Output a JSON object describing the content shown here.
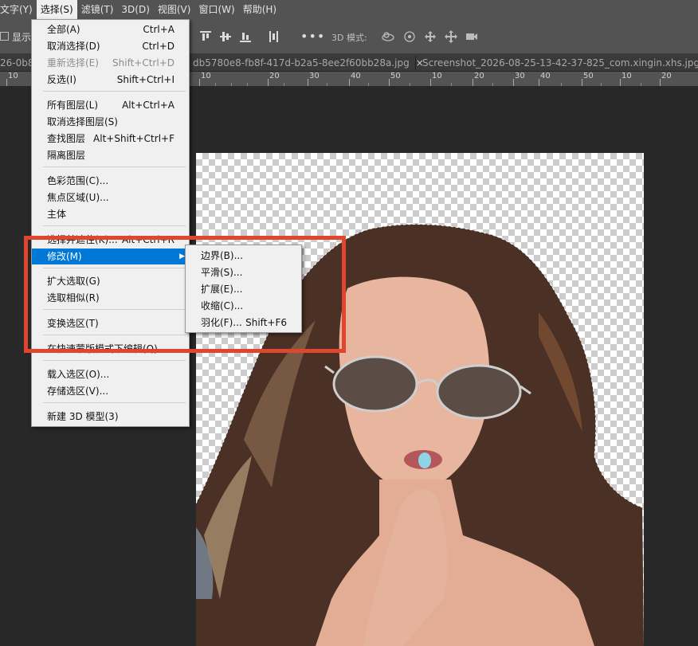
{
  "menubar": {
    "items": [
      "文字(Y)",
      "选择(S)",
      "滤镜(T)",
      "3D(D)",
      "视图(V)",
      "窗口(W)",
      "帮助(H)"
    ],
    "active_index": 1
  },
  "options": {
    "show_label": "显示",
    "label_3d": "3D 模式:",
    "more": "•••"
  },
  "tabs": [
    {
      "label": "26-0b86",
      "close": ""
    },
    {
      "label": "db5780e8-fb8f-417d-b2a5-8ee2f60bb28a.jpg",
      "close": "×"
    },
    {
      "label": "Screenshot_2026-08-25-13-42-37-825_com.xingin.xhs.jpg",
      "close": "×"
    }
  ],
  "ruler": [
    "10",
    "10",
    "20",
    "30",
    "40",
    "50",
    "10",
    "20",
    "30",
    "40",
    "50",
    "10",
    "20"
  ],
  "select_menu": {
    "items": [
      {
        "label": "全部(A)",
        "shortcut": "Ctrl+A",
        "disabled": false
      },
      {
        "label": "取消选择(D)",
        "shortcut": "Ctrl+D",
        "disabled": false
      },
      {
        "label": "重新选择(E)",
        "shortcut": "Shift+Ctrl+D",
        "disabled": true
      },
      {
        "label": "反选(I)",
        "shortcut": "Shift+Ctrl+I",
        "disabled": false
      },
      {
        "label": "所有图层(L)",
        "shortcut": "Alt+Ctrl+A",
        "disabled": false
      },
      {
        "label": "取消选择图层(S)",
        "shortcut": "",
        "disabled": false
      },
      {
        "label": "查找图层",
        "shortcut": "Alt+Shift+Ctrl+F",
        "disabled": false
      },
      {
        "label": "隔离图层",
        "shortcut": "",
        "disabled": false
      },
      {
        "label": "色彩范围(C)...",
        "shortcut": "",
        "disabled": false
      },
      {
        "label": "焦点区域(U)...",
        "shortcut": "",
        "disabled": false
      },
      {
        "label": "主体",
        "shortcut": "",
        "disabled": false
      },
      {
        "label": "选择并遮住(K)...",
        "shortcut": "Alt+Ctrl+R",
        "disabled": false
      },
      {
        "label": "修改(M)",
        "shortcut": "",
        "disabled": false,
        "highlighted": true,
        "submenu": "▶"
      },
      {
        "label": "扩大选取(G)",
        "shortcut": "",
        "disabled": false
      },
      {
        "label": "选取相似(R)",
        "shortcut": "",
        "disabled": false
      },
      {
        "label": "变换选区(T)",
        "shortcut": "",
        "disabled": false
      },
      {
        "label": "在快速蒙版模式下编辑(Q)",
        "shortcut": "",
        "disabled": false
      },
      {
        "label": "载入选区(O)...",
        "shortcut": "",
        "disabled": false
      },
      {
        "label": "存储选区(V)...",
        "shortcut": "",
        "disabled": false
      },
      {
        "label": "新建 3D 模型(3)",
        "shortcut": "",
        "disabled": false
      }
    ]
  },
  "modify_submenu": {
    "items": [
      {
        "label": "边界(B)...",
        "shortcut": ""
      },
      {
        "label": "平滑(S)...",
        "shortcut": ""
      },
      {
        "label": "扩展(E)...",
        "shortcut": ""
      },
      {
        "label": "收缩(C)...",
        "shortcut": ""
      },
      {
        "label": "羽化(F)...",
        "shortcut": "Shift+F6"
      }
    ]
  },
  "colors": {
    "accent": "#0078d7",
    "highlight_box": "#e0462e",
    "menubar_bg": "#535353",
    "canvas_bg": "#282828"
  }
}
